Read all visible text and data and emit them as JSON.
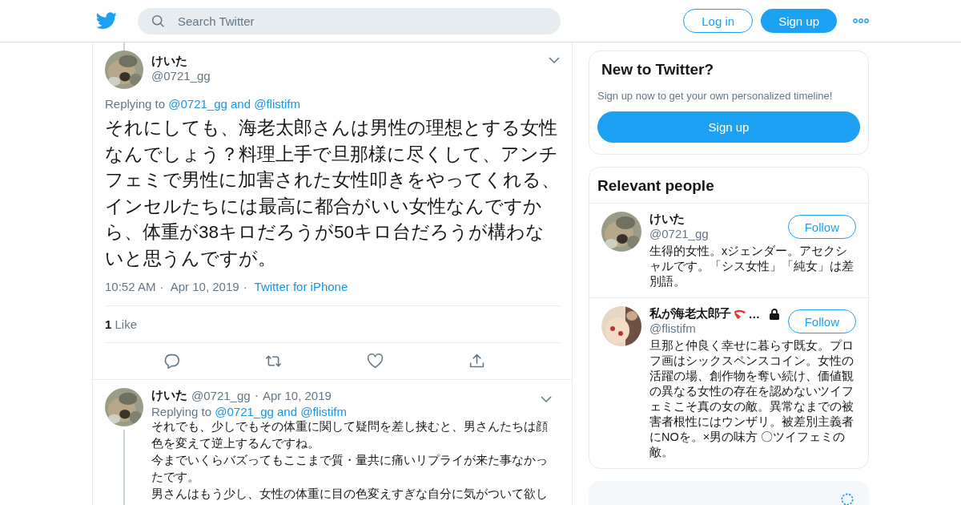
{
  "header": {
    "search": {
      "placeholder": "Search Twitter"
    },
    "login": "Log in",
    "signup": "Sign up"
  },
  "tweet": {
    "name": "けいた",
    "handle": "@0721_gg",
    "replying_label": "Replying to",
    "replying_to": "@0721_gg and @flistifm",
    "text": "それにしても、海老太郎さんは男性の理想とする女性なんでしょう？料理上手で旦那様に尽くして、アンチフェミで男性に加害された女性叩きをやってくれる、インセルたちには最高に都合がいい女性なんですから、体重が38キロだろうが50キロ台だろうが構わないと思うんですが。",
    "time": "10:52 AM",
    "separator": "·",
    "separator_2": "·",
    "date": "Apr 10, 2019",
    "source": "Twitter for iPhone",
    "likes_count": "1",
    "likes_label": "Like"
  },
  "reply": {
    "name": "けいた",
    "handle": "@0721_gg",
    "separator": "·",
    "date": "Apr 10, 2019",
    "replying_label": "Replying to",
    "replying_to": "@0721_gg and @flistifm",
    "paragraphs": [
      "それでも、少しでもその体重に関して疑問を差し挟むと、男さんたちは顔色を変えて逆上するんですね。",
      "今までいくらバズってもここまで質・量共に痛いリプライが来た事なかったです。",
      "男さんはもう少し、女性の体重に目の色変えすぎな自分に気がついて欲し"
    ]
  },
  "signup_card": {
    "title": "New to Twitter?",
    "text": "Sign up now to get your own personalized timeline!",
    "button": "Sign up"
  },
  "relevant_people": {
    "title": "Relevant people",
    "people": [
      {
        "name": "けいた",
        "emoji": false,
        "protected": false,
        "handle": "@0721_gg",
        "follow": "Follow",
        "bio": "生得的女性。xジェンダー。アセクシャルです。「シス女性」「純女」は差別語。"
      },
      {
        "name": "私が海老太郎子",
        "name_suffix": "…",
        "emoji": true,
        "protected": true,
        "handle": "@flistifm",
        "follow": "Follow",
        "bio": "旦那と仲良く幸せに暮らす既女。プロフ画はシックスペンスコイン。女性の活躍の場、創作物を奪い続け、価値観の異なる女性の存在を認めないツイフェミこそ真の女の敵。異常なまでの被害者根性にはウンザリ。被差別主義者にNOを。×男の味方 〇ツイフェミの敵。"
      }
    ]
  }
}
